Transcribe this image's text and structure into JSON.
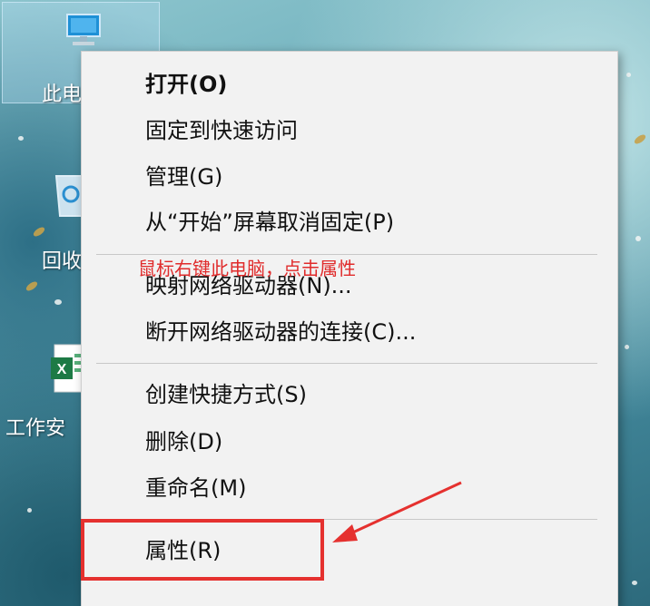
{
  "desktop": {
    "icons": [
      {
        "name": "this-pc",
        "label": "此电"
      },
      {
        "name": "recycle-bin",
        "label": "回收"
      },
      {
        "name": "excel-file",
        "label": "工作安"
      }
    ]
  },
  "context_menu": {
    "groups": [
      [
        "打开(O)",
        "固定到快速访问",
        "管理(G)",
        "从“开始”屏幕取消固定(P)"
      ],
      [
        "映射网络驱动器(N)...",
        "断开网络驱动器的连接(C)..."
      ],
      [
        "创建快捷方式(S)",
        "删除(D)",
        "重命名(M)"
      ],
      [
        "属性(R)"
      ]
    ]
  },
  "annotation": {
    "text": "鼠标右键此电脑，点击属性",
    "color": "#e02b2b",
    "highlight_color": "#e5312f"
  }
}
